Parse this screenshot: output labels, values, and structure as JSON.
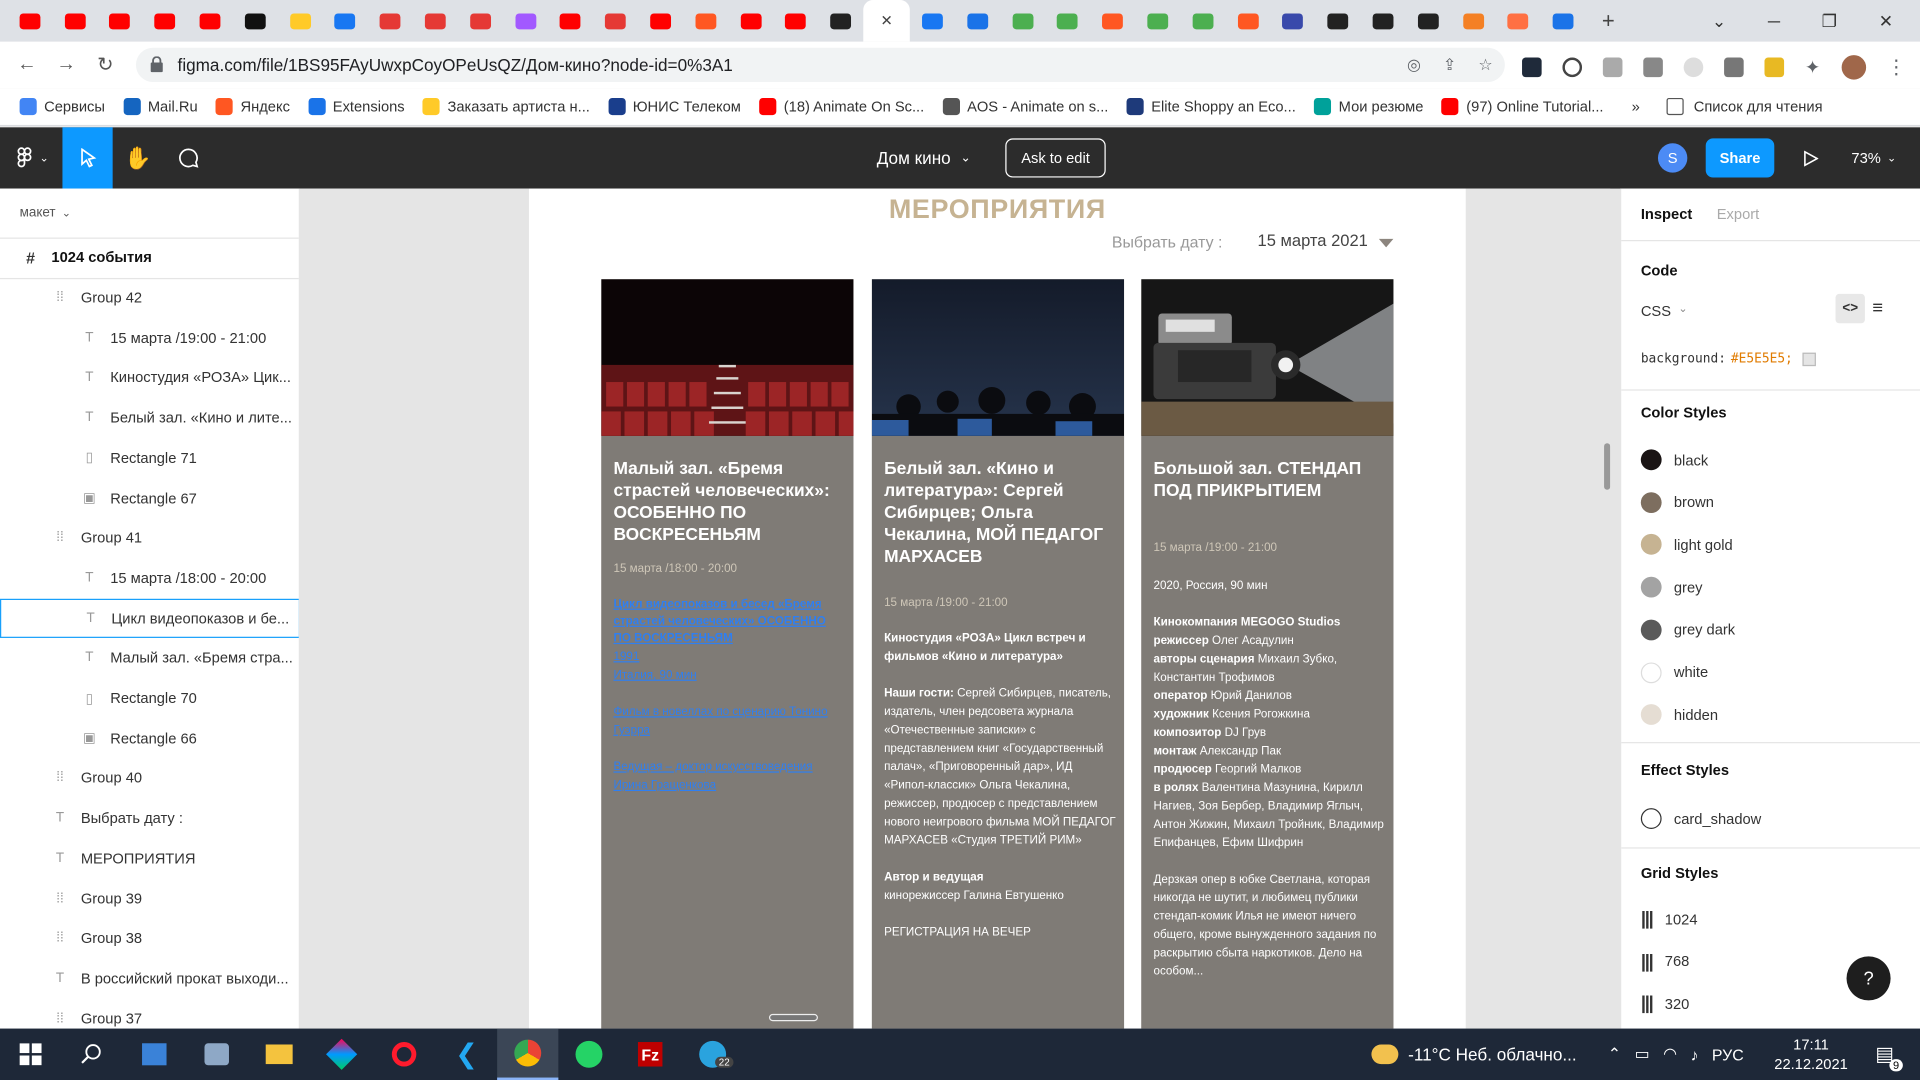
{
  "browser": {
    "url": "figma.com/file/1BS95FAyUwxpCoyOPeUsQZ/Дом-кино?node-id=0%3A1",
    "bookmarks": [
      "Сервисы",
      "Mail.Ru",
      "Яндекс",
      "Extensions",
      "Заказать артиста н...",
      "ЮНИС Телеком",
      "(18) Animate On Sc...",
      "AOS - Animate on s...",
      "Elite Shoppy an Eco...",
      "Мои резюме",
      "(97) Online Tutorial..."
    ],
    "bookmarks_more": "»",
    "reading_list": "Список для чтения",
    "new_tab": "+"
  },
  "figma": {
    "file_name": "Дом кино",
    "ask_to_edit": "Ask to edit",
    "share": "Share",
    "avatar_letter": "S",
    "zoom": "73%",
    "accent": "#0d99ff"
  },
  "layers": {
    "page": "макет",
    "frame": "1024 события",
    "items": [
      {
        "name": "Group 42",
        "type": "group",
        "indent": 1
      },
      {
        "name": "15 марта /19:00 - 21:00",
        "type": "text",
        "indent": 2
      },
      {
        "name": "Киностудия «РОЗА» Цик...",
        "type": "text",
        "indent": 2
      },
      {
        "name": "Белый зал. «Кино и лите...",
        "type": "text",
        "indent": 2
      },
      {
        "name": "Rectangle 71",
        "type": "rect",
        "indent": 2
      },
      {
        "name": "Rectangle 67",
        "type": "image",
        "indent": 2
      },
      {
        "name": "Group 41",
        "type": "group",
        "indent": 1
      },
      {
        "name": "15 марта /18:00 - 20:00",
        "type": "text",
        "indent": 2
      },
      {
        "name": "Цикл видеопоказов и бе...",
        "type": "text",
        "indent": 2,
        "selected": true
      },
      {
        "name": "Малый зал. «Бремя стра...",
        "type": "text",
        "indent": 2
      },
      {
        "name": "Rectangle 70",
        "type": "rect",
        "indent": 2
      },
      {
        "name": "Rectangle 66",
        "type": "image",
        "indent": 2
      },
      {
        "name": "Group 40",
        "type": "group",
        "indent": 1
      },
      {
        "name": "Выбрать дату :",
        "type": "text",
        "indent": 1
      },
      {
        "name": "МЕРОПРИЯТИЯ",
        "type": "text",
        "indent": 1
      },
      {
        "name": "Group 39",
        "type": "group",
        "indent": 1
      },
      {
        "name": "Group 38",
        "type": "group",
        "indent": 1
      },
      {
        "name": "В российский прокат выходи...",
        "type": "text",
        "indent": 1
      },
      {
        "name": "Group 37",
        "type": "group",
        "indent": 1
      }
    ]
  },
  "design": {
    "heading": "МЕРОПРИЯТИЯ",
    "date_label": "Выбрать дату :",
    "date_value": "15 марта 2021",
    "cards": [
      {
        "title": "Малый зал. «Бремя страстей человеческих»: ОСОБЕННО ПО ВОСКРЕСЕНЬЯМ",
        "time": "15 марта /18:00 - 20:00",
        "body": "Цикл видеопоказов и бесед «Бремя страстей человеческих» ОСОБЕННО ПО ВОСКРЕСЕНЬЯМ",
        "year": "1991",
        "country": "Италия, 90 мин",
        "film": "Фильм в новеллах по сценарию Тонино Гуэрра",
        "host": "Ведущая – доктор искусствоведения Ирина Гращенкова"
      },
      {
        "title": "Белый зал. «Кино и литература»: Сергей Сибирцев; Ольга Чекалина, МОЙ ПЕДАГОГ МАРХАСЕВ",
        "time": "15 марта /19:00 - 21:00",
        "intro": "Киностудия «РОЗА» Цикл встреч и фильмов «Кино и литература»",
        "guests_label": "Наши гости:",
        "guests": "Сергей Сибирцев, писатель, издатель, член редсовета журнала «Отечественные записки» с представлением книг «Государственный палач», «Приговоренный дар», ИД «Рипол-классик» Ольга Чекалина, режиссер, продюсер с представлением нового неигрового фильма МОЙ ПЕДАГОГ МАРХАСЕВ «Студия ТРЕТИЙ РИМ»",
        "author_label": "Автор и ведущая",
        "author": "кинорежиссер Галина Евтушенко",
        "register": "РЕГИСТРАЦИЯ НА ВЕЧЕР"
      },
      {
        "title": "Большой зал. СТЕНДАП ПОД ПРИКРЫТИЕМ",
        "time": "15 марта /19:00 - 21:00",
        "meta": "2020, Россия, 90 мин",
        "credits": [
          {
            "k": "Кинокомпания MEGOGO Studios",
            "v": ""
          },
          {
            "k": "режиссер",
            "v": "Олег Асадулин"
          },
          {
            "k": "авторы сценария",
            "v": "Михаил Зубко, Константин Трофимов"
          },
          {
            "k": "оператор",
            "v": "Юрий Данилов"
          },
          {
            "k": "художник",
            "v": "Ксения Рогожкина"
          },
          {
            "k": "композитор",
            "v": "DJ Грув"
          },
          {
            "k": "монтаж",
            "v": "Александр Пак"
          },
          {
            "k": "продюсер",
            "v": "Георгий Малков"
          },
          {
            "k": "в ролях",
            "v": "Валентина Мазунина, Кирилл Нагиев, Зоя Бербер, Владимир Яглыч, Антон Жижин, Михаил Тройник, Владимир Епифанцев, Ефим Шифрин"
          }
        ],
        "synopsis": "Дерзкая опер в юбке Светлана, которая никогда не шутит, и любимец публики стендап-комик Илья не имеют ничего общего, кроме вынужденного задания по раскрытию сбыта наркотиков. Дело на особом..."
      }
    ]
  },
  "inspect": {
    "tabs": [
      "Inspect",
      "Export"
    ],
    "code_label": "Code",
    "lang": "CSS",
    "css_prop": "background:",
    "css_value": "#E5E5E5;",
    "color_styles_label": "Color Styles",
    "colors": [
      {
        "name": "black",
        "hex": "#1a1414"
      },
      {
        "name": "brown",
        "hex": "#7d6e5f"
      },
      {
        "name": "light gold",
        "hex": "#c6b392"
      },
      {
        "name": "grey",
        "hex": "#a3a3a3"
      },
      {
        "name": "grey dark",
        "hex": "#5a5a5a"
      },
      {
        "name": "white",
        "hex": "#ffffff"
      },
      {
        "name": "hidden",
        "hex": "#e5ddd3"
      }
    ],
    "effect_styles_label": "Effect Styles",
    "effects": [
      "card_shadow"
    ],
    "grid_styles_label": "Grid Styles",
    "grids": [
      "1024",
      "768",
      "320"
    ],
    "help": "?"
  },
  "taskbar": {
    "weather": "-11°C  Неб. облачно...",
    "lang": "РУС",
    "time": "17:11",
    "date": "22.12.2021",
    "notif_count": "9",
    "telegram_badge": "22"
  }
}
